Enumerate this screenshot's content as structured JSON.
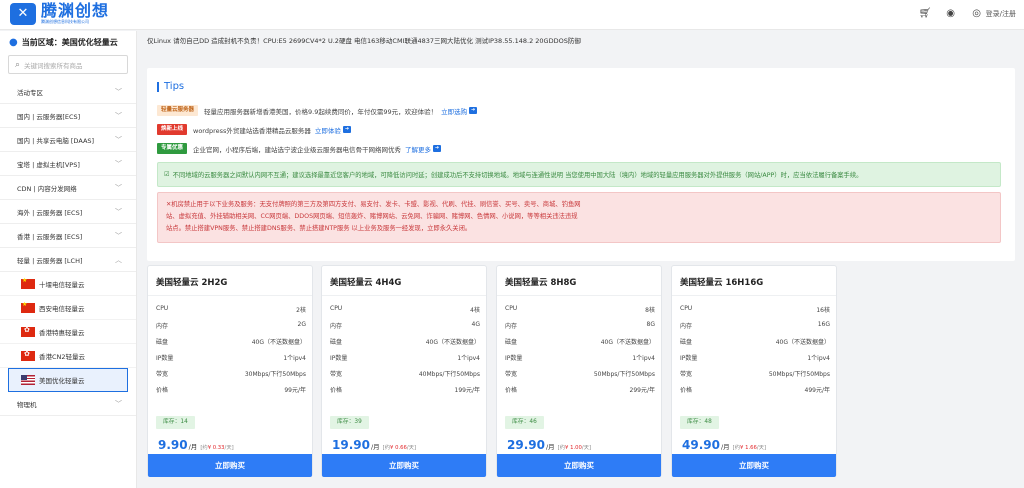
{
  "header": {
    "logo_name": "腾渊创想",
    "logo_sub": "腾渊创想信息科技有限公司",
    "login": "登录/注册",
    "icons": [
      "cart-icon",
      "globe-icon",
      "user-icon"
    ]
  },
  "sidebar": {
    "region": "当前区域：美国优化轻量云",
    "search_placeholder": "关键词搜索所有商品",
    "categories": [
      {
        "label": "活动专区"
      },
      {
        "label": "国内 | 云服务器[ECS]"
      },
      {
        "label": "国内 | 共享云电脑 [DAAS]"
      },
      {
        "label": "宝塔 | 虚拟主机[VPS]"
      },
      {
        "label": "CDN | 内容分发网络"
      },
      {
        "label": "海外 | 云服务器 [ECS]"
      },
      {
        "label": "香港 | 云服务器 [ECS]"
      },
      {
        "label": "轻量 | 云服务器 [LCH]"
      }
    ],
    "subitems": [
      {
        "label": "十堰电信轻量云",
        "flag": "cn"
      },
      {
        "label": "西安电信轻量云",
        "flag": "cn"
      },
      {
        "label": "香港特惠轻量云",
        "flag": "hk"
      },
      {
        "label": "香港CN2轻量云",
        "flag": "hk"
      },
      {
        "label": "美国优化轻量云",
        "flag": "us"
      }
    ],
    "last_category": "物理机"
  },
  "notice": "仅Linux 请勿自己DD 造成封机不负责！CPU:E5 2699CV4*2 U.2硬盘 电信163移动CMI联通4837三网大陆优化 测试IP38.55.148.2 20GDDOS防御",
  "tips": {
    "title": "Tips",
    "items": [
      {
        "tag": "轻量云服务器",
        "text": "轻量应用服务器新增香港美国，价格9.9起续费同价，年付仅需99元，欢迎体验！",
        "link": "立即选购"
      },
      {
        "tag": "焕新上线",
        "text": "wordpress外贸建站选香港精品云服务器",
        "link": "立即体验"
      },
      {
        "tag": "专属优惠",
        "text": "企业官网，小程序后端，建站选宁波企业级云服务器电信骨干网络网优秀",
        "link": "了解更多"
      }
    ],
    "green": "不同地域的云服务器之间默认内网不互通；建议选择最靠近您客户的地域，可降低访问时延；创建成功后不支持切换地域。地域与连通性说明 当您使用中国大陆（境内）地域的轻量应用服务器对外提供服务（网站/APP）时，应当依法履行备案手续。",
    "red": [
      "机房禁止用于以下业务及服务：无支付牌照的第三方及第四方支付、易支付、发卡、卡盟、影视、代刷、代挂、刷信誉、买号、卖号、商城、钓鱼网",
      "站、虚拟充值、外挂辅助相关网、CC网页端、DDOS网页端、短信轰炸、赌博网站、云免网、诈骗网、赌博网、色情网、小说网，等等相关违法违规",
      "站点。禁止搭建VPN服务、禁止搭建DNS服务、禁止搭建NTP服务 以上业务及服务一经发现，立即永久关闭。"
    ]
  },
  "spec_labels": [
    "CPU",
    "内存",
    "磁盘",
    "IP数量",
    "带宽",
    "价格"
  ],
  "products": [
    {
      "title": "美国轻量云 2H2G",
      "specs": [
        "2核",
        "2G",
        "40G（不送数据盘）",
        "1个ipv4",
        "30Mbps/下行50Mbps",
        "99元/年"
      ],
      "stock": "库存：14",
      "price": "9.90",
      "unit": "/月",
      "per_day_prefix": "[约",
      "per_day": "¥ 0.33",
      "per_day_suffix": "/天]",
      "buy": "立即购买"
    },
    {
      "title": "美国轻量云 4H4G",
      "specs": [
        "4核",
        "4G",
        "40G（不送数据盘）",
        "1个ipv4",
        "40Mbps/下行50Mbps",
        "199元/年"
      ],
      "stock": "库存：39",
      "price": "19.90",
      "unit": "/月",
      "per_day_prefix": "[约",
      "per_day": "¥ 0.66",
      "per_day_suffix": "/天]",
      "buy": "立即购买"
    },
    {
      "title": "美国轻量云 8H8G",
      "specs": [
        "8核",
        "8G",
        "40G（不送数据盘）",
        "1个ipv4",
        "50Mbps/下行50Mbps",
        "299元/年"
      ],
      "stock": "库存：46",
      "price": "29.90",
      "unit": "/月",
      "per_day_prefix": "[约",
      "per_day": "¥ 1.00",
      "per_day_suffix": "/天]",
      "buy": "立即购买"
    },
    {
      "title": "美国轻量云 16H16G",
      "specs": [
        "16核",
        "16G",
        "40G（不送数据盘）",
        "1个ipv4",
        "50Mbps/下行50Mbps",
        "499元/年"
      ],
      "stock": "库存：48",
      "price": "49.90",
      "unit": "/月",
      "per_day_prefix": "[约",
      "per_day": "¥ 1.66",
      "per_day_suffix": "/天]",
      "buy": "立即购买"
    }
  ],
  "colors": {
    "accent": "#1e6fe0",
    "button": "#2e7cf6",
    "danger": "#c8383b",
    "success": "#3a8a41"
  }
}
